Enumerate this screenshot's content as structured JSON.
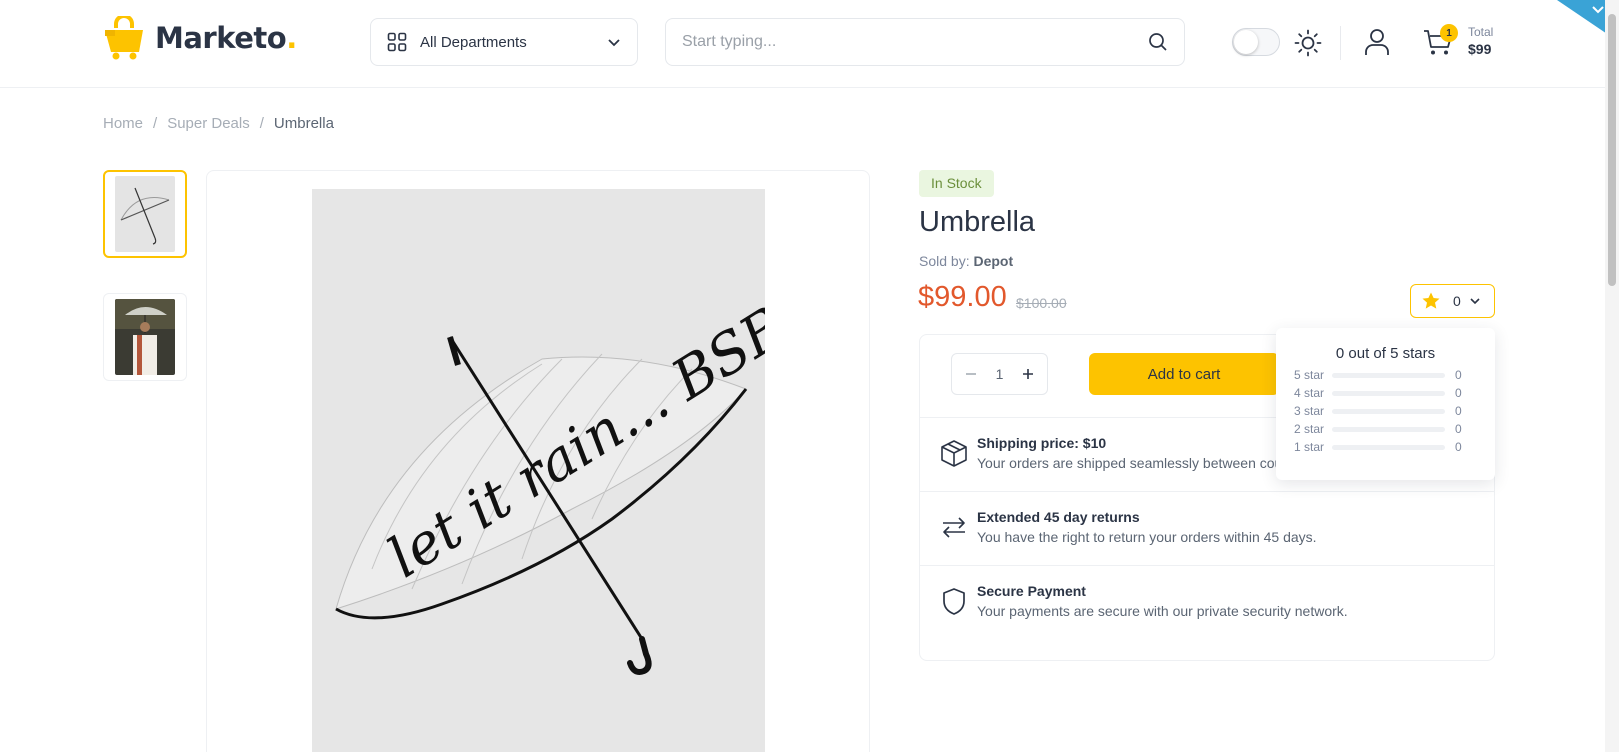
{
  "brand": {
    "name": "Marketo",
    "dot": ".",
    "accent": "#fdc300",
    "price_color": "#e2582c"
  },
  "header": {
    "department_label": "All Departments",
    "search_placeholder": "Start typing...",
    "cart_count": "1",
    "cart_total_label": "Total",
    "cart_total_value": "$99",
    "icons": [
      "grid-icon",
      "chevron-down-icon",
      "search-icon",
      "sun-icon",
      "user-icon",
      "cart-icon"
    ]
  },
  "breadcrumb": {
    "items": [
      "Home",
      "Super Deals",
      "Umbrella"
    ],
    "separator": "/"
  },
  "product": {
    "stock": "In Stock",
    "title": "Umbrella",
    "sold_by_label": "Sold by:",
    "seller": "Depot",
    "price": "$99.00",
    "old_price": "$100.00",
    "quantity": "1",
    "add_to_cart": "Add to cart"
  },
  "rating": {
    "count": "0",
    "popup_title": "0 out of 5 stars",
    "rows": [
      {
        "label": "5 star",
        "count": "0",
        "fraction": 0
      },
      {
        "label": "4 star",
        "count": "0",
        "fraction": 0
      },
      {
        "label": "3 star",
        "count": "0",
        "fraction": 0
      },
      {
        "label": "2 star",
        "count": "0",
        "fraction": 0
      },
      {
        "label": "1 star",
        "count": "0",
        "fraction": 0
      }
    ]
  },
  "features": [
    {
      "title": "Shipping price: $10",
      "desc": "Your orders are shipped seamlessly between countries",
      "icon": "box-icon"
    },
    {
      "title": "Extended 45 day returns",
      "desc": "You have the right to return your orders within 45 days.",
      "icon": "returns-icon"
    },
    {
      "title": "Secure Payment",
      "desc": "Your payments are secure with our private security network.",
      "icon": "shield-icon"
    }
  ],
  "image_text": "let it rain... BSB"
}
